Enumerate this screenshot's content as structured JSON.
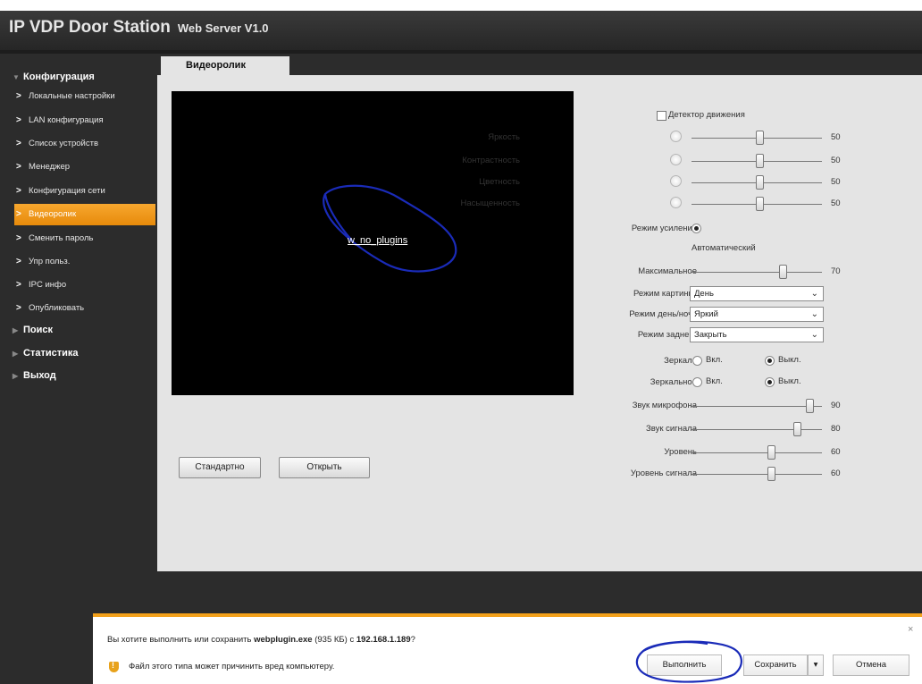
{
  "app": {
    "title": "IP VDP Door Station",
    "subtitle": "Web Server V1.0"
  },
  "sidebar": {
    "sections": [
      {
        "label": "Конфигурация",
        "expanded": true
      },
      {
        "label": "Поиск",
        "expanded": false
      },
      {
        "label": "Статистика",
        "expanded": false
      },
      {
        "label": "Выход",
        "expanded": false
      }
    ],
    "items": [
      {
        "label": "Локальные настройки"
      },
      {
        "label": "LAN конфигурация"
      },
      {
        "label": "Список устройств"
      },
      {
        "label": "Менеджер"
      },
      {
        "label": "Конфигурация сети"
      },
      {
        "label": "Видеоролик",
        "active": true
      },
      {
        "label": "Сменить пароль"
      },
      {
        "label": "Упр польз."
      },
      {
        "label": "IPC инфо"
      },
      {
        "label": "Опубликовать"
      }
    ]
  },
  "tab": {
    "label": "Видеоролик"
  },
  "video": {
    "plugin_link": "w_no_plugins"
  },
  "buttons": {
    "standard": "Стандартно",
    "open": "Открыть"
  },
  "settings": {
    "motion_detector": "Детектор движения",
    "brightness": {
      "label": "Яркость",
      "value": "50"
    },
    "contrast": {
      "label": "Контрастность",
      "value": "50"
    },
    "hue": {
      "label": "Цветность",
      "value": "50"
    },
    "saturation": {
      "label": "Насыщенность",
      "value": "50"
    },
    "gain_mode": {
      "label": "Режим усиления",
      "option": "Автоматический"
    },
    "maximum": {
      "label": "Максимальное",
      "value": "70"
    },
    "picture_mode": {
      "label": "Режим картинки",
      "value": "День"
    },
    "day_night_mode": {
      "label": "Режим день/ночь",
      "value": "Яркий"
    },
    "backlight_mode": {
      "label": "Режим заднего",
      "value": "Закрыть"
    },
    "mirror": {
      "label": "Зеркало",
      "on": "Вкл.",
      "off": "Выкл."
    },
    "mirror2": {
      "label": "Зеркальное",
      "on": "Вкл.",
      "off": "Выкл."
    },
    "mic_volume": {
      "label": "Звук микрофона",
      "value": "90"
    },
    "signal_sound": {
      "label": "Звук сигнала",
      "value": "80"
    },
    "level": {
      "label": "Уровень",
      "value": "60"
    },
    "signal_level": {
      "label": "Уровень сигнала",
      "value": "60"
    }
  },
  "download": {
    "prompt_pre": "Вы хотите выполнить или сохранить ",
    "file": "webplugin.exe",
    "size": " (935 КБ) с ",
    "host": "192.168.1.189",
    "prompt_post": "?",
    "warning": "Файл этого типа может причинить вред компьютеру.",
    "run": "Выполнить",
    "save": "Сохранить",
    "cancel": "Отмена",
    "close": "×"
  }
}
